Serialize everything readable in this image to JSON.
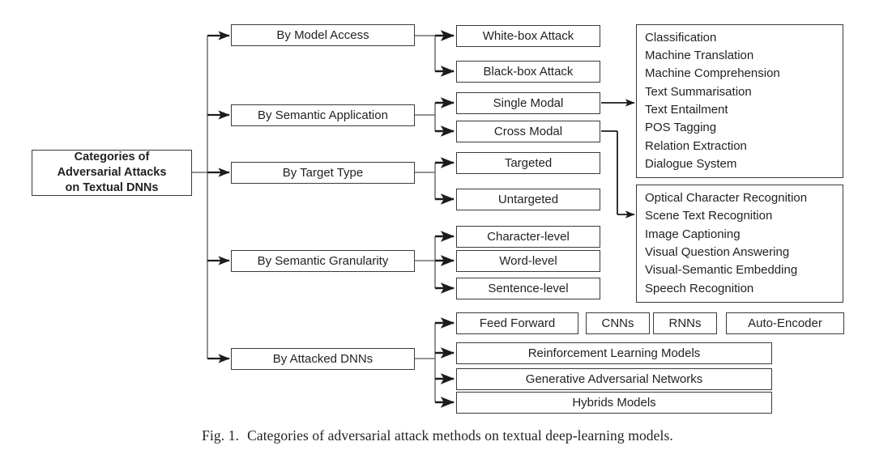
{
  "figure": {
    "caption_label": "Fig. 1.",
    "caption_text": "Categories of adversarial attack methods on textual deep-learning models.",
    "line_color": "#3a3a3a",
    "text_color": "#231f20",
    "background": "#ffffff"
  },
  "root": {
    "line1": "Categories of",
    "line2": "Adversarial Attacks",
    "line3": "on Textual DNNs"
  },
  "categories": [
    {
      "label": "By Model Access"
    },
    {
      "label": "By Semantic Application"
    },
    {
      "label": "By Target Type"
    },
    {
      "label": "By Semantic Granularity"
    },
    {
      "label": "By Attacked DNNs"
    }
  ],
  "leaves": {
    "model_access": [
      {
        "label": "White-box Attack"
      },
      {
        "label": "Black-box Attack"
      }
    ],
    "semantic_application": [
      {
        "label": "Single Modal"
      },
      {
        "label": "Cross Modal"
      }
    ],
    "target_type": [
      {
        "label": "Targeted"
      },
      {
        "label": "Untargeted"
      }
    ],
    "semantic_granularity": [
      {
        "label": "Character-level"
      },
      {
        "label": "Word-level"
      },
      {
        "label": "Sentence-level"
      }
    ],
    "attacked_dnns": [
      {
        "label": "Feed Forward"
      },
      {
        "label": "CNNs"
      },
      {
        "label": "RNNs"
      },
      {
        "label": "Auto-Encoder"
      },
      {
        "label": "Reinforcement Learning Models"
      },
      {
        "label": "Generative Adversarial Networks"
      },
      {
        "label": "Hybrids Models"
      }
    ]
  },
  "task_lists": {
    "single_modal_tasks": [
      "Classification",
      "Machine Translation",
      "Machine Comprehension",
      "Text Summarisation",
      "Text Entailment",
      "POS Tagging",
      "Relation Extraction",
      "Dialogue System"
    ],
    "cross_modal_tasks": [
      "Optical Character Recognition",
      "Scene Text Recognition",
      "Image Captioning",
      "Visual Question Answering",
      "Visual-Semantic Embedding",
      "Speech Recognition"
    ]
  }
}
